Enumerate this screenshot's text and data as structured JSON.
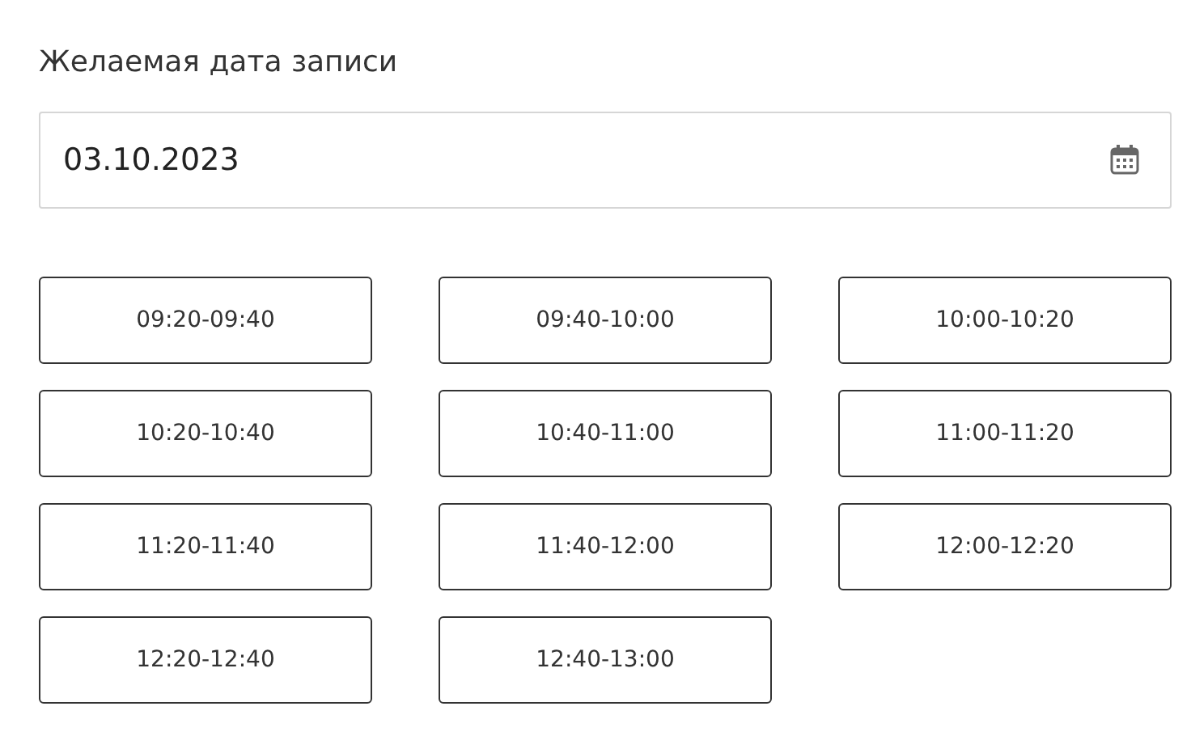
{
  "date_field": {
    "label": "Желаемая дата записи",
    "value": "03.10.2023"
  },
  "time_slots": [
    {
      "label": "09:20-09:40"
    },
    {
      "label": "09:40-10:00"
    },
    {
      "label": "10:00-10:20"
    },
    {
      "label": "10:20-10:40"
    },
    {
      "label": "10:40-11:00"
    },
    {
      "label": "11:00-11:20"
    },
    {
      "label": "11:20-11:40"
    },
    {
      "label": "11:40-12:00"
    },
    {
      "label": "12:00-12:20"
    },
    {
      "label": "12:20-12:40"
    },
    {
      "label": "12:40-13:00"
    }
  ]
}
